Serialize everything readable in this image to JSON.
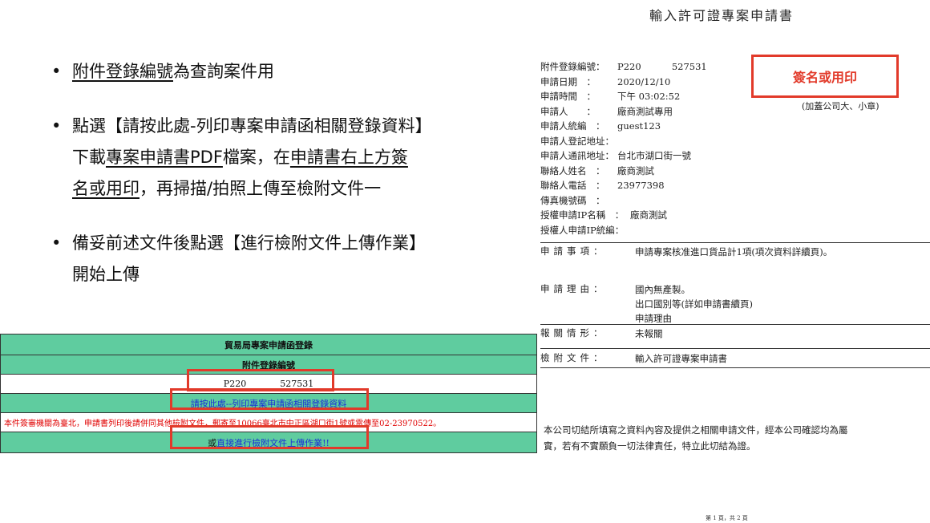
{
  "bullets": {
    "b1_underlined": "附件登錄編號",
    "b1_rest": "為查詢案件用",
    "b2_l1": "點選【請按此處-列印專案申請函相關登錄資料】",
    "b2_l2_a": "下載",
    "b2_l2_u1": "專案申請書PDF",
    "b2_l2_b": "檔案，在",
    "b2_l2_u2": "申請書右上方簽",
    "b2_l3_u": "名或用印",
    "b2_l3_rest": "，再掃描/拍照上傳至檢附文件一",
    "b3_l1": "備妥前述文件後點選【進行檢附文件上傳作業】",
    "b3_l2": "開始上傳"
  },
  "form": {
    "title": "貿易局專案申請函登錄",
    "attach_label": "附件登錄編號",
    "attach_prefix": "P220",
    "attach_number": "527531",
    "print_link": "請按此處--列印專案申請函相關登錄資料",
    "notice": "本件簽審機關為臺北，申請書列印後請併同其他檢附文件，郵寄至10066臺北市中正區湖口街1號或電傳至02-23970522。",
    "upload_prefix": "或",
    "upload_link": "直接進行檢附文件上傳作業!!"
  },
  "document": {
    "title": "輸入許可證專案申請書",
    "fields": [
      {
        "label": "附件登錄編號：",
        "value": "P220　　　 527531"
      },
      {
        "label": "申請日期　：",
        "value": "2020/12/10"
      },
      {
        "label": "申請時間　：",
        "value": "下午 03:02:52"
      },
      {
        "label": "申請人　　：",
        "value": "廠商測試專用"
      },
      {
        "label": "申請人統編　：",
        "value": "guest123"
      },
      {
        "label": "申請人登記地址：",
        "value": ""
      },
      {
        "label": "申請人通訊地址：",
        "value": "台北市湖口街一號"
      },
      {
        "label": "聯絡人姓名　：",
        "value": "廠商測試"
      },
      {
        "label": "聯絡人電話　：",
        "value": "23977398"
      },
      {
        "label": "傳真機號碼　：",
        "value": ""
      },
      {
        "label": "授權申請IP名稱　：",
        "value": "廠商測試"
      },
      {
        "label": "授權人申請IP統編：",
        "value": ""
      }
    ],
    "seal_text": "簽名或用印",
    "seal_note": "(加蓋公司大、小章)",
    "item_label": "申請事項：",
    "item_value": "申請專案核准進口貨品計1項(項次資料詳續頁)。",
    "reason_label": "申請理由：",
    "reason_lines": [
      "國內無產製。",
      "出口國別等(詳如申請書續頁)",
      "申請理由"
    ],
    "customs_label": "報關情形：",
    "customs_value": "未報關",
    "attach_doc_label": "檢附文件：",
    "attach_doc_value": "輸入許可證專案申請書",
    "declaration_l1": "本公司切結所填寫之資料內容及提供之相關申請文件，經本公司確認均為屬",
    "declaration_l2": "實，若有不實願負一切法律責任，特立此切結為證。",
    "page": "第 1 頁，共 2 頁"
  }
}
